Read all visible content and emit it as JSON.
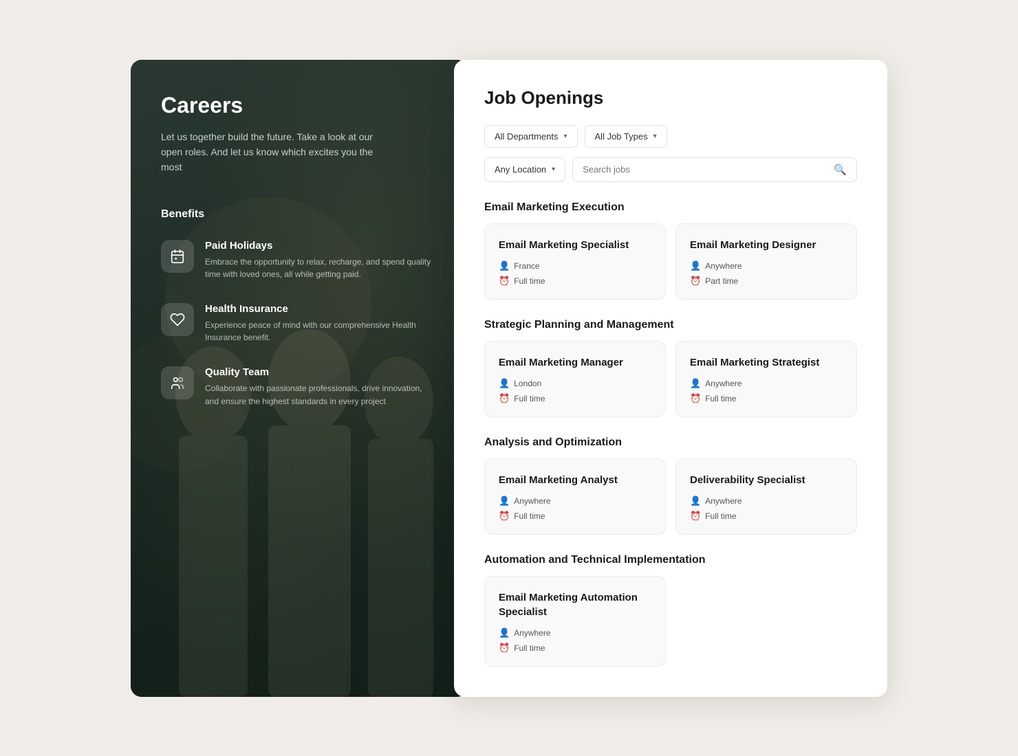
{
  "left": {
    "title": "Careers",
    "subtitle": "Let us together build the future. Take a look at our open roles. And let us know which excites you the most",
    "benefits_heading": "Benefits",
    "benefits": [
      {
        "id": "paid-holidays",
        "icon": "📅",
        "title": "Paid Holidays",
        "description": "Embrace the opportunity to relax, recharge, and spend quality time with loved ones, all while getting paid."
      },
      {
        "id": "health-insurance",
        "icon": "♥",
        "title": "Health Insurance",
        "description": "Experience peace of mind with our comprehensive Health Insurance benefit."
      },
      {
        "id": "quality-team",
        "icon": "👥",
        "title": "Quality Team",
        "description": "Collaborate with passionate professionals, drive innovation, and ensure the highest standards in every project"
      }
    ]
  },
  "right": {
    "title": "Job Openings",
    "filters": {
      "department_label": "All Departments",
      "job_type_label": "All Job Types",
      "location_label": "Any Location",
      "search_placeholder": "Search jobs"
    },
    "categories": [
      {
        "id": "execution",
        "label": "Email Marketing Execution",
        "jobs": [
          {
            "id": "specialist",
            "title": "Email Marketing Specialist",
            "location": "France",
            "type": "Full time"
          },
          {
            "id": "designer",
            "title": "Email Marketing Designer",
            "location": "Anywhere",
            "type": "Part time"
          }
        ]
      },
      {
        "id": "strategic",
        "label": "Strategic Planning and Management",
        "jobs": [
          {
            "id": "manager",
            "title": "Email Marketing Manager",
            "location": "London",
            "type": "Full time"
          },
          {
            "id": "strategist",
            "title": "Email Marketing Strategist",
            "location": "Anywhere",
            "type": "Full time"
          }
        ]
      },
      {
        "id": "analysis",
        "label": "Analysis and Optimization",
        "jobs": [
          {
            "id": "analyst",
            "title": "Email Marketing Analyst",
            "location": "Anywhere",
            "type": "Full time"
          },
          {
            "id": "deliverability",
            "title": "Deliverability Specialist",
            "location": "Anywhere",
            "type": "Full time"
          }
        ]
      },
      {
        "id": "automation",
        "label": "Automation and Technical Implementation",
        "jobs": [
          {
            "id": "automation-specialist",
            "title": "Email Marketing Automation Specialist",
            "location": "Anywhere",
            "type": "Full time"
          }
        ]
      }
    ]
  }
}
